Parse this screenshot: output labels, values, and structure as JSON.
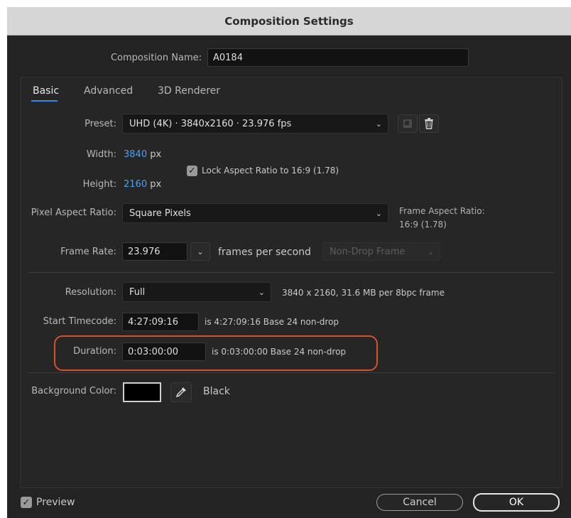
{
  "dialog": {
    "title": "Composition Settings"
  },
  "comp_name": {
    "label": "Composition Name:",
    "value": "A0184"
  },
  "tabs": [
    {
      "label": "Basic",
      "active": true
    },
    {
      "label": "Advanced",
      "active": false
    },
    {
      "label": "3D Renderer",
      "active": false
    }
  ],
  "preset": {
    "label": "Preset:",
    "value": "UHD (4K)  ·  3840x2160 · 23.976 fps"
  },
  "width": {
    "label": "Width:",
    "value": "3840",
    "unit": "px"
  },
  "height": {
    "label": "Height:",
    "value": "2160",
    "unit": "px"
  },
  "lock_aspect": {
    "label": "Lock Aspect Ratio to 16:9 (1.78)",
    "checked": true
  },
  "pixel_aspect": {
    "label": "Pixel Aspect Ratio:",
    "value": "Square Pixels"
  },
  "frame_aspect": {
    "label": "Frame Aspect Ratio:",
    "value": "16:9 (1.78)"
  },
  "frame_rate": {
    "label": "Frame Rate:",
    "value": "23.976",
    "unit": "frames per second",
    "drop_frame": "Non-Drop Frame"
  },
  "resolution": {
    "label": "Resolution:",
    "value": "Full",
    "info": "3840 x 2160, 31.6 MB per 8bpc frame"
  },
  "start_timecode": {
    "label": "Start Timecode:",
    "value": "4:27:09:16",
    "info": "is 4:27:09:16  Base 24   non-drop"
  },
  "duration": {
    "label": "Duration:",
    "value": "0:03:00:00",
    "info": "is 0:03:00:00  Base 24   non-drop"
  },
  "background": {
    "label": "Background Color:",
    "color_name": "Black",
    "swatch": "#000000"
  },
  "footer": {
    "preview_label": "Preview",
    "preview_checked": true,
    "cancel_label": "Cancel",
    "ok_label": "OK"
  },
  "colors": {
    "accent": "#2d8ceb",
    "highlight": "#d8502f",
    "value_blue": "#4f9fef"
  }
}
